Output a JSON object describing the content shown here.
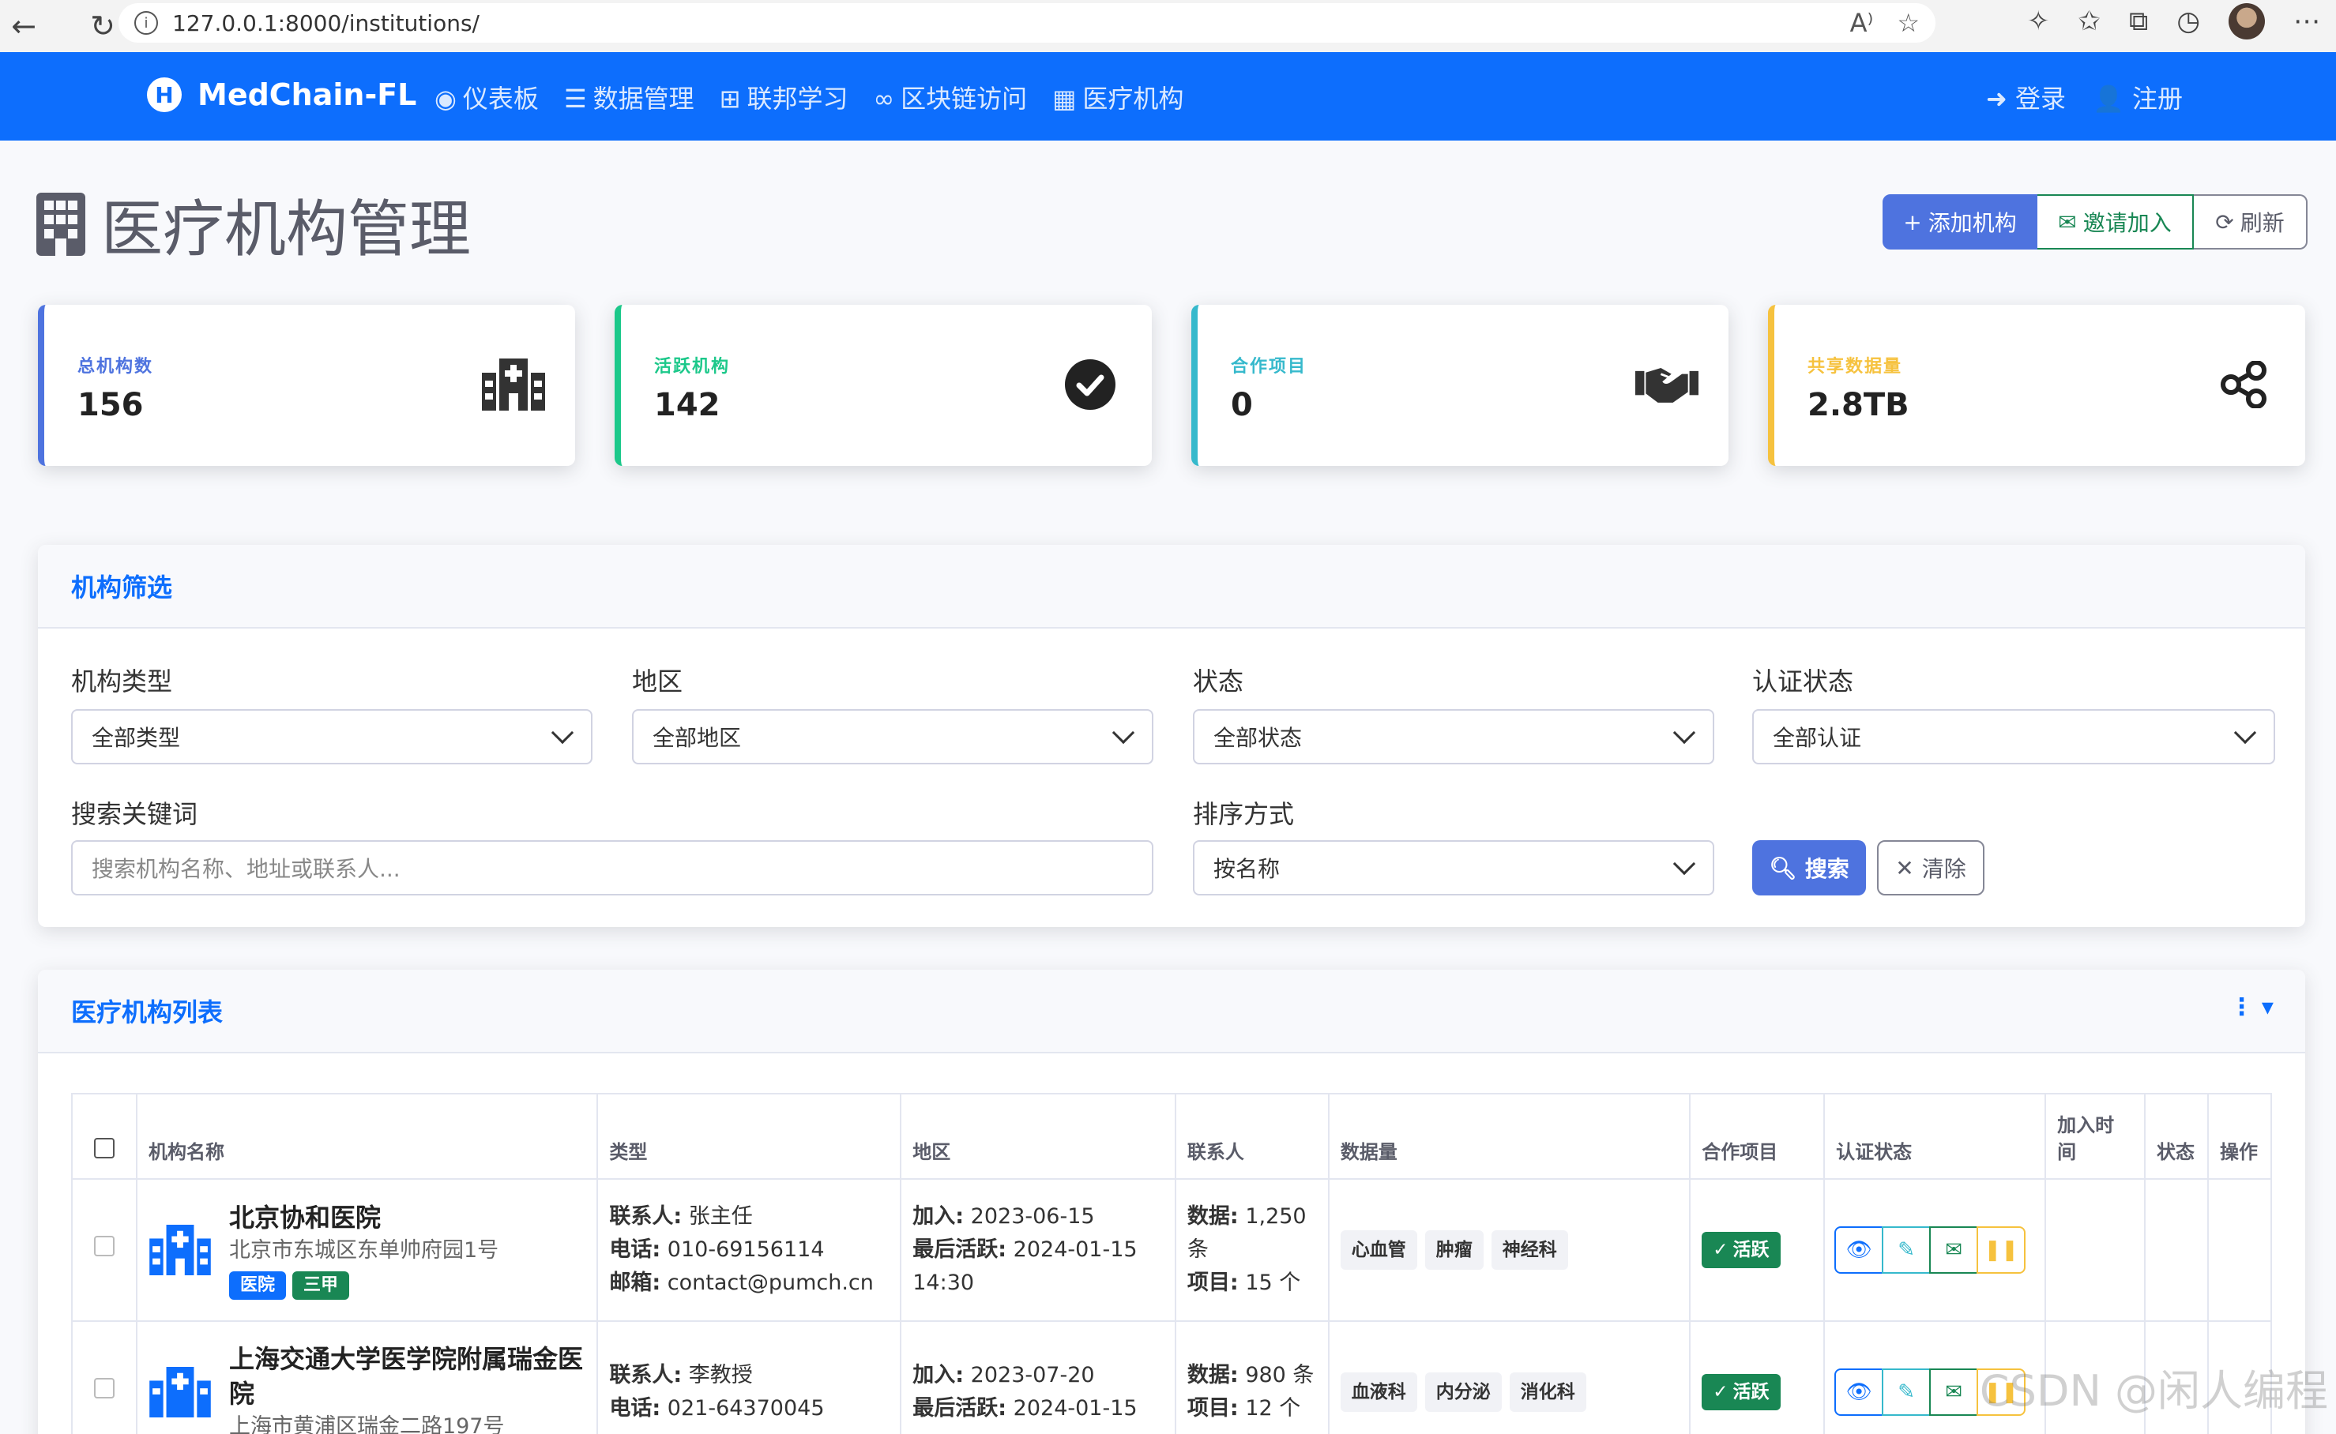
{
  "browser": {
    "url": "127.0.0.1:8000/institutions/"
  },
  "navbar": {
    "brand": "MedChain-FL",
    "links": [
      {
        "label": "仪表板",
        "icon": "palette-icon"
      },
      {
        "label": "数据管理",
        "icon": "database-icon"
      },
      {
        "label": "联邦学习",
        "icon": "sitemap-icon"
      },
      {
        "label": "区块链访问",
        "icon": "link-icon"
      },
      {
        "label": "医疗机构",
        "icon": "building-icon"
      }
    ],
    "login": "登录",
    "register": "注册"
  },
  "page": {
    "title": "医疗机构管理",
    "add_button": "添加机构",
    "invite_button": "邀请加入",
    "refresh_button": "刷新"
  },
  "stats": [
    {
      "label": "总机构数",
      "value": "156",
      "color": "#4e73df",
      "icon": "hospital-icon"
    },
    {
      "label": "活跃机构",
      "value": "142",
      "color": "#1cc88a",
      "icon": "check-circle-icon"
    },
    {
      "label": "合作项目",
      "value": "0",
      "color": "#36b9cc",
      "icon": "handshake-icon"
    },
    {
      "label": "共享数据量",
      "value": "2.8TB",
      "color": "#f6c23e",
      "icon": "share-icon"
    }
  ],
  "filters": {
    "title": "机构筛选",
    "type_label": "机构类型",
    "type_value": "全部类型",
    "region_label": "地区",
    "region_value": "全部地区",
    "status_label": "状态",
    "status_value": "全部状态",
    "cert_label": "认证状态",
    "cert_value": "全部认证",
    "keyword_label": "搜索关键词",
    "keyword_placeholder": "搜索机构名称、地址或联系人...",
    "sort_label": "排序方式",
    "sort_value": "按名称",
    "search_button": "搜索",
    "clear_button": "清除"
  },
  "list": {
    "title": "医疗机构列表",
    "columns": [
      "机构名称",
      "类型",
      "地区",
      "联系人",
      "数据量",
      "合作项目",
      "认证状态",
      "加入时间",
      "状态",
      "操作"
    ],
    "rows": [
      {
        "name": "北京协和医院",
        "address": "北京市东城区东单帅府园1号",
        "tags": [
          {
            "text": "医院",
            "color": "#0d6efd"
          },
          {
            "text": "三甲",
            "color": "#198754"
          }
        ],
        "contact_label": "联系人:",
        "contact": "张主任",
        "phone_label": "电话:",
        "phone": "010-69156114",
        "email_label": "邮箱:",
        "email": "contact@pumch.cn",
        "join_label": "加入:",
        "join": "2023-06-15",
        "last_label": "最后活跃:",
        "last": "2024-01-15 14:30",
        "data_label": "数据:",
        "data": "1,250 条",
        "project_label": "项目:",
        "project": "15 个",
        "depts": [
          "心血管",
          "肿瘤",
          "神经科"
        ],
        "status": "活跃"
      },
      {
        "name": "上海交通大学医学院附属瑞金医院",
        "address": "上海市黄浦区瑞金二路197号",
        "contact_label": "联系人:",
        "contact": "李教授",
        "phone_label": "电话:",
        "phone": "021-64370045",
        "join_label": "加入:",
        "join": "2023-07-20",
        "last_label": "最后活跃:",
        "last": "2024-01-15",
        "data_label": "数据:",
        "data": "980 条",
        "project_label": "项目:",
        "project": "12 个",
        "depts": [
          "血液科",
          "内分泌",
          "消化科"
        ],
        "status": "活跃"
      }
    ]
  },
  "watermark": "CSDN @闲人编程"
}
